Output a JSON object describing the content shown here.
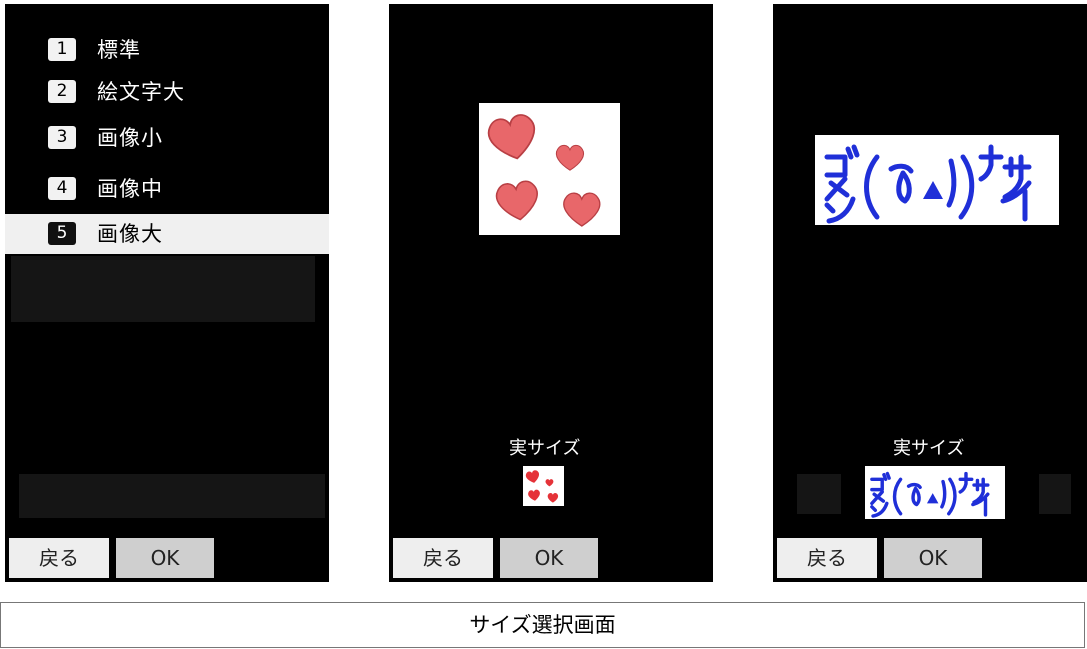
{
  "screen1": {
    "menu": [
      {
        "num": "1",
        "label": "標準"
      },
      {
        "num": "2",
        "label": "絵文字大"
      },
      {
        "num": "3",
        "label": "画像小"
      },
      {
        "num": "4",
        "label": "画像中"
      },
      {
        "num": "5",
        "label": "画像大"
      }
    ],
    "back_label": "戻る",
    "ok_label": "OK"
  },
  "screen2": {
    "actual_size_label": "実サイズ",
    "back_label": "戻る",
    "ok_label": "OK"
  },
  "screen3": {
    "actual_size_label": "実サイズ",
    "back_label": "戻る",
    "ok_label": "OK"
  },
  "caption": "サイズ選択画面",
  "colors": {
    "screen_bg": "#000000",
    "heart": "#e8676a",
    "heart_outline": "#b83f44",
    "emoticon_blue": "#1f2fd8"
  },
  "icons": [
    "heart-stamp-icon",
    "gomen-nasai-stamp-icon"
  ]
}
